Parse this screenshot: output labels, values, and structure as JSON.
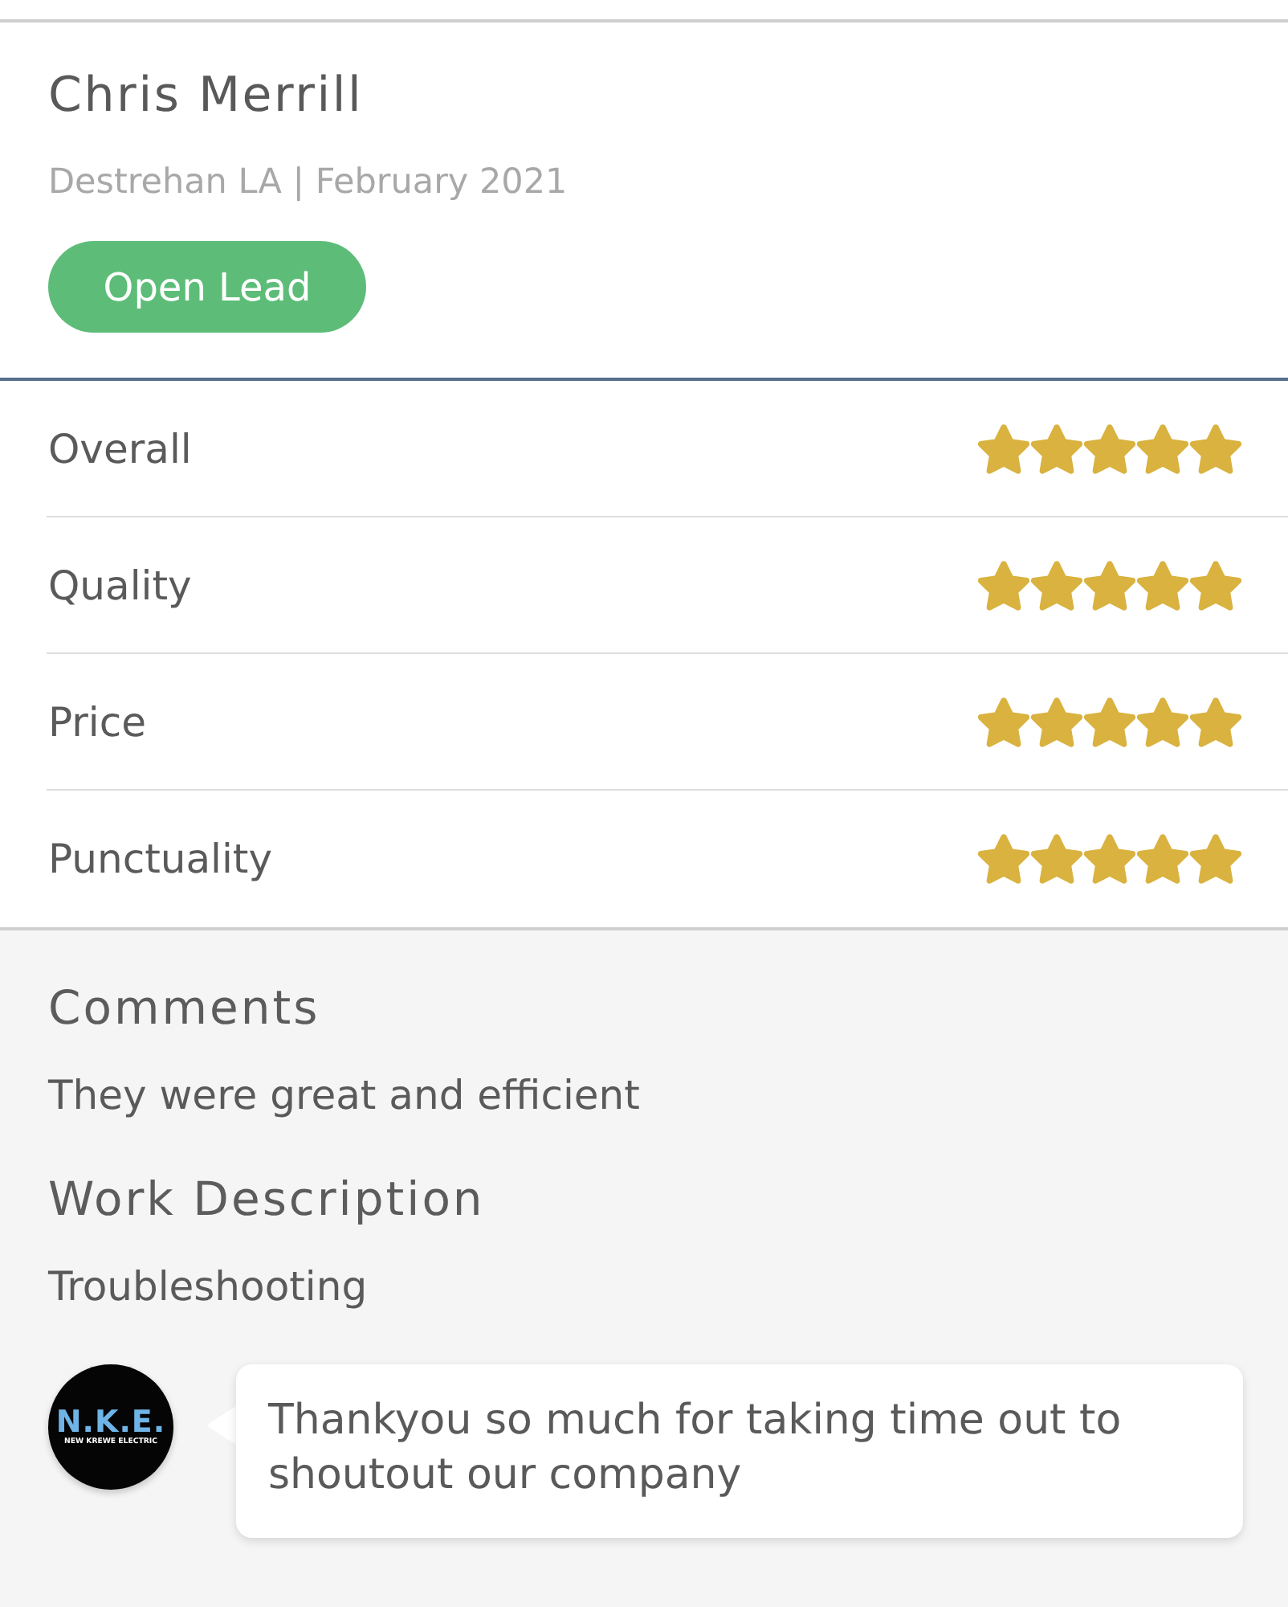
{
  "review": {
    "reviewer": "Chris Merrill",
    "location_date": "Destrehan LA | February 2021",
    "button": "Open Lead"
  },
  "ratings": [
    {
      "label": "Overall",
      "stars": 5
    },
    {
      "label": "Quality",
      "stars": 5
    },
    {
      "label": "Price",
      "stars": 5
    },
    {
      "label": "Punctuality",
      "stars": 5
    }
  ],
  "comments": {
    "heading": "Comments",
    "text": "They were great and efficient"
  },
  "work_description": {
    "heading": "Work Description",
    "text": "Troubleshooting"
  },
  "reply": {
    "avatar": {
      "title": "N.K.E.",
      "subtitle": "NEW KREWE ELECTRIC"
    },
    "text": "Thankyou so much for taking time out to shoutout our company"
  }
}
